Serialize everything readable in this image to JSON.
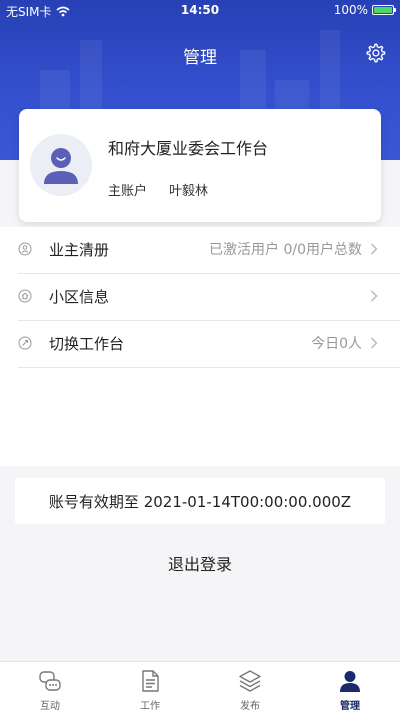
{
  "status_bar": {
    "carrier": "无SIM卡",
    "time": "14:50",
    "battery": "100%"
  },
  "header": {
    "title": "管理"
  },
  "profile": {
    "name": "和府大厦业委会工作台",
    "account_type": "主账户",
    "user_name": "叶毅林"
  },
  "menu": {
    "items": [
      {
        "label": "业主清册",
        "value": "已激活用户 0/0用户总数",
        "icon": "user-circle-icon"
      },
      {
        "label": "小区信息",
        "value": "",
        "icon": "home-circle-icon"
      },
      {
        "label": "切换工作台",
        "value": "今日0人",
        "icon": "switch-circle-icon"
      }
    ]
  },
  "account": {
    "validity": "账号有效期至 2021-01-14T00:00:00.000Z",
    "logout_label": "退出登录"
  },
  "tabs": [
    {
      "label": "互动",
      "icon": "interaction-icon"
    },
    {
      "label": "工作",
      "icon": "document-icon"
    },
    {
      "label": "发布",
      "icon": "layers-icon"
    },
    {
      "label": "管理",
      "icon": "person-icon"
    }
  ],
  "colors": {
    "header_blue": "#2f4bc6",
    "active_tab": "#1a2a6c",
    "battery_green": "#4cd964"
  }
}
